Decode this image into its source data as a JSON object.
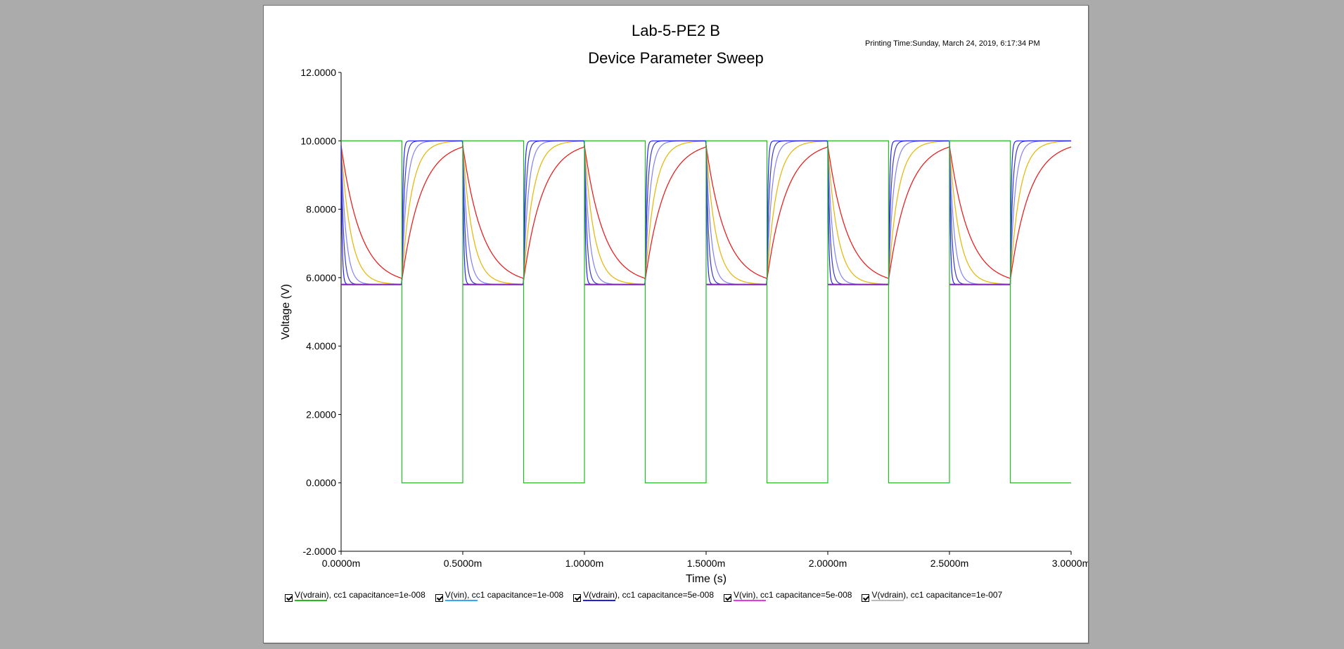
{
  "header": {
    "title": "Lab-5-PE2 B",
    "subtitle": "Device Parameter Sweep",
    "printing_time": "Printing Time:Sunday, March 24, 2019, 6:17:34 PM"
  },
  "chart_data": {
    "type": "line",
    "title": "Lab-5-PE2 B",
    "subtitle": "Device Parameter Sweep",
    "xlabel": "Time (s)",
    "ylabel": "Voltage (V)",
    "xlim": [
      0,
      3.0
    ],
    "ylim": [
      -2,
      12
    ],
    "x_unit_note": "m",
    "xticks": [
      0,
      0.5,
      1.0,
      1.5,
      2.0,
      2.5,
      3.0
    ],
    "xtick_labels": [
      "0.0000m",
      "0.5000m",
      "1.0000m",
      "1.5000m",
      "2.0000m",
      "2.5000m",
      "3.0000m"
    ],
    "yticks": [
      -2,
      0,
      2,
      4,
      6,
      8,
      10,
      12
    ],
    "ytick_labels": [
      "-2.0000",
      "0.0000",
      "2.0000",
      "4.0000",
      "6.0000",
      "8.0000",
      "10.0000",
      "12.0000"
    ],
    "grid": false,
    "legend_position": "bottom",
    "input_square_wave": {
      "high": 10,
      "low": 0,
      "period_ms": 0.5,
      "low_phase_start_ms": 0.25,
      "color": "#22bb22"
    },
    "drain_response": {
      "low_level": 5.8,
      "high_level": 10,
      "curves": [
        {
          "color": "#2222ff",
          "tau_ms": 0.004
        },
        {
          "color": "#3a3ad0",
          "tau_ms": 0.01
        },
        {
          "color": "#8080ff",
          "tau_ms": 0.02
        },
        {
          "color": "#e8b400",
          "tau_ms": 0.04
        },
        {
          "color": "#ee1111",
          "tau_ms": 0.08
        }
      ]
    },
    "series": [
      {
        "name": "V(vdrain), cc1 capacitance=1e-008",
        "color": "#22bb22"
      },
      {
        "name": "V(vin), cc1 capacitance=1e-008",
        "color": "#33a8ff"
      },
      {
        "name": "V(vdrain), cc1 capacitance=5e-008",
        "color": "#2222dd"
      },
      {
        "name": "V(vin), cc1 capacitance=5e-008",
        "color": "#ee33ee"
      },
      {
        "name": "V(vdrain), cc1 capacitance=1e-007",
        "color": "#bbbbbb"
      }
    ]
  }
}
